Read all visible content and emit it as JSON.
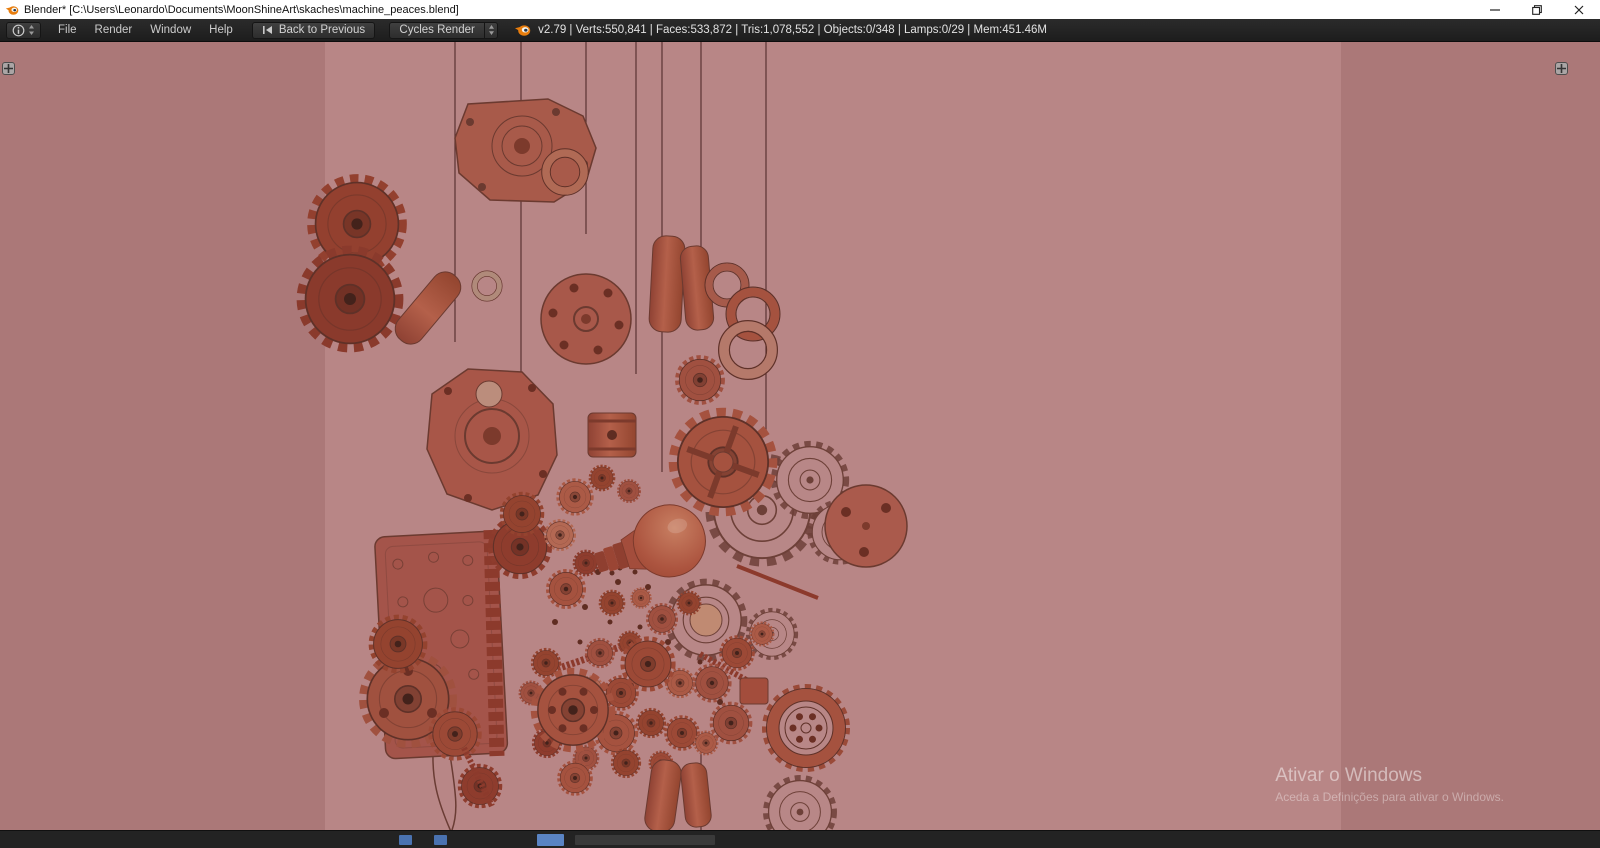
{
  "window": {
    "title": "Blender* [C:\\Users\\Leonardo\\Documents\\MoonShineArt\\skaches\\machine_peaces.blend]"
  },
  "menubar": {
    "menus": [
      {
        "label": "File"
      },
      {
        "label": "Render"
      },
      {
        "label": "Window"
      },
      {
        "label": "Help"
      }
    ],
    "back_button": "Back to Previous",
    "engine": "Cycles Render",
    "stats": "v2.79 | Verts:550,841 | Faces:533,872 | Tris:1,078,552 | Objects:0/348 | Lamps:0/29 | Mem:451.46M"
  },
  "viewport": {
    "watermark": {
      "line1": "Ativar o Windows",
      "line2": "Aceda a Definições para ativar o Windows."
    }
  },
  "icons": {
    "editor_type": "info-circle",
    "back": "left-arrow-bar",
    "stepper": "up-down-triangles"
  },
  "colors": {
    "viewport_outer": "#ab7878",
    "viewport_camera": "#b88686",
    "clay_material": "#a05040",
    "header_background": "#222222",
    "titlebar_background": "#ffffff",
    "blender_orange": "#e87d0d",
    "timeline_accent": "#4a72b0"
  }
}
